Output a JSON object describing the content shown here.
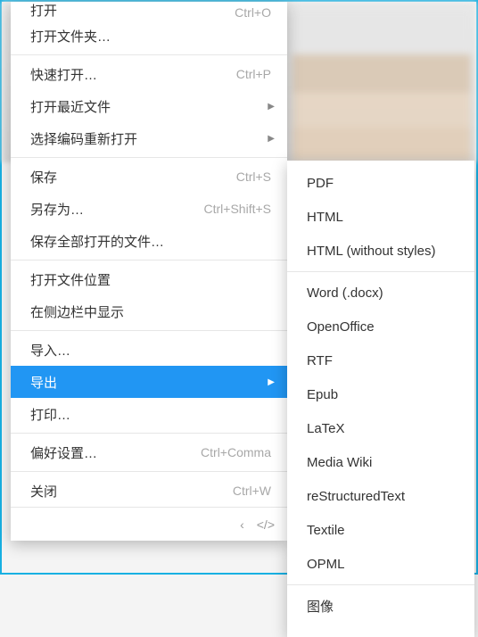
{
  "menu": {
    "items": [
      {
        "label": "打开",
        "shortcut": "Ctrl+O",
        "arrow": false,
        "partial": true
      },
      {
        "label": "打开文件夹…",
        "shortcut": "",
        "arrow": false
      },
      {
        "sep": true
      },
      {
        "label": "快速打开…",
        "shortcut": "Ctrl+P",
        "arrow": false
      },
      {
        "label": "打开最近文件",
        "shortcut": "",
        "arrow": true
      },
      {
        "label": "选择编码重新打开",
        "shortcut": "",
        "arrow": true
      },
      {
        "sep": true
      },
      {
        "label": "保存",
        "shortcut": "Ctrl+S",
        "arrow": false
      },
      {
        "label": "另存为…",
        "shortcut": "Ctrl+Shift+S",
        "arrow": false
      },
      {
        "label": "保存全部打开的文件…",
        "shortcut": "",
        "arrow": false
      },
      {
        "sep": true
      },
      {
        "label": "打开文件位置",
        "shortcut": "",
        "arrow": false
      },
      {
        "label": "在侧边栏中显示",
        "shortcut": "",
        "arrow": false
      },
      {
        "sep": true
      },
      {
        "label": "导入…",
        "shortcut": "",
        "arrow": false
      },
      {
        "label": "导出",
        "shortcut": "",
        "arrow": true,
        "highlight": true
      },
      {
        "label": "打印…",
        "shortcut": "",
        "arrow": false
      },
      {
        "sep": true
      },
      {
        "label": "偏好设置…",
        "shortcut": "Ctrl+Comma",
        "arrow": false
      },
      {
        "sep": true
      },
      {
        "label": "关闭",
        "shortcut": "Ctrl+W",
        "arrow": false
      }
    ],
    "footer": {
      "chev": "‹",
      "code": "</>"
    }
  },
  "submenu": {
    "items": [
      {
        "label": "PDF"
      },
      {
        "label": "HTML"
      },
      {
        "label": "HTML (without styles)"
      },
      {
        "sep": true
      },
      {
        "label": "Word (.docx)"
      },
      {
        "label": "OpenOffice"
      },
      {
        "label": "RTF"
      },
      {
        "label": "Epub"
      },
      {
        "label": "LaTeX"
      },
      {
        "label": "Media Wiki"
      },
      {
        "label": "reStructuredText"
      },
      {
        "label": "Textile"
      },
      {
        "label": "OPML"
      },
      {
        "sep": true
      },
      {
        "label": "图像"
      }
    ]
  }
}
